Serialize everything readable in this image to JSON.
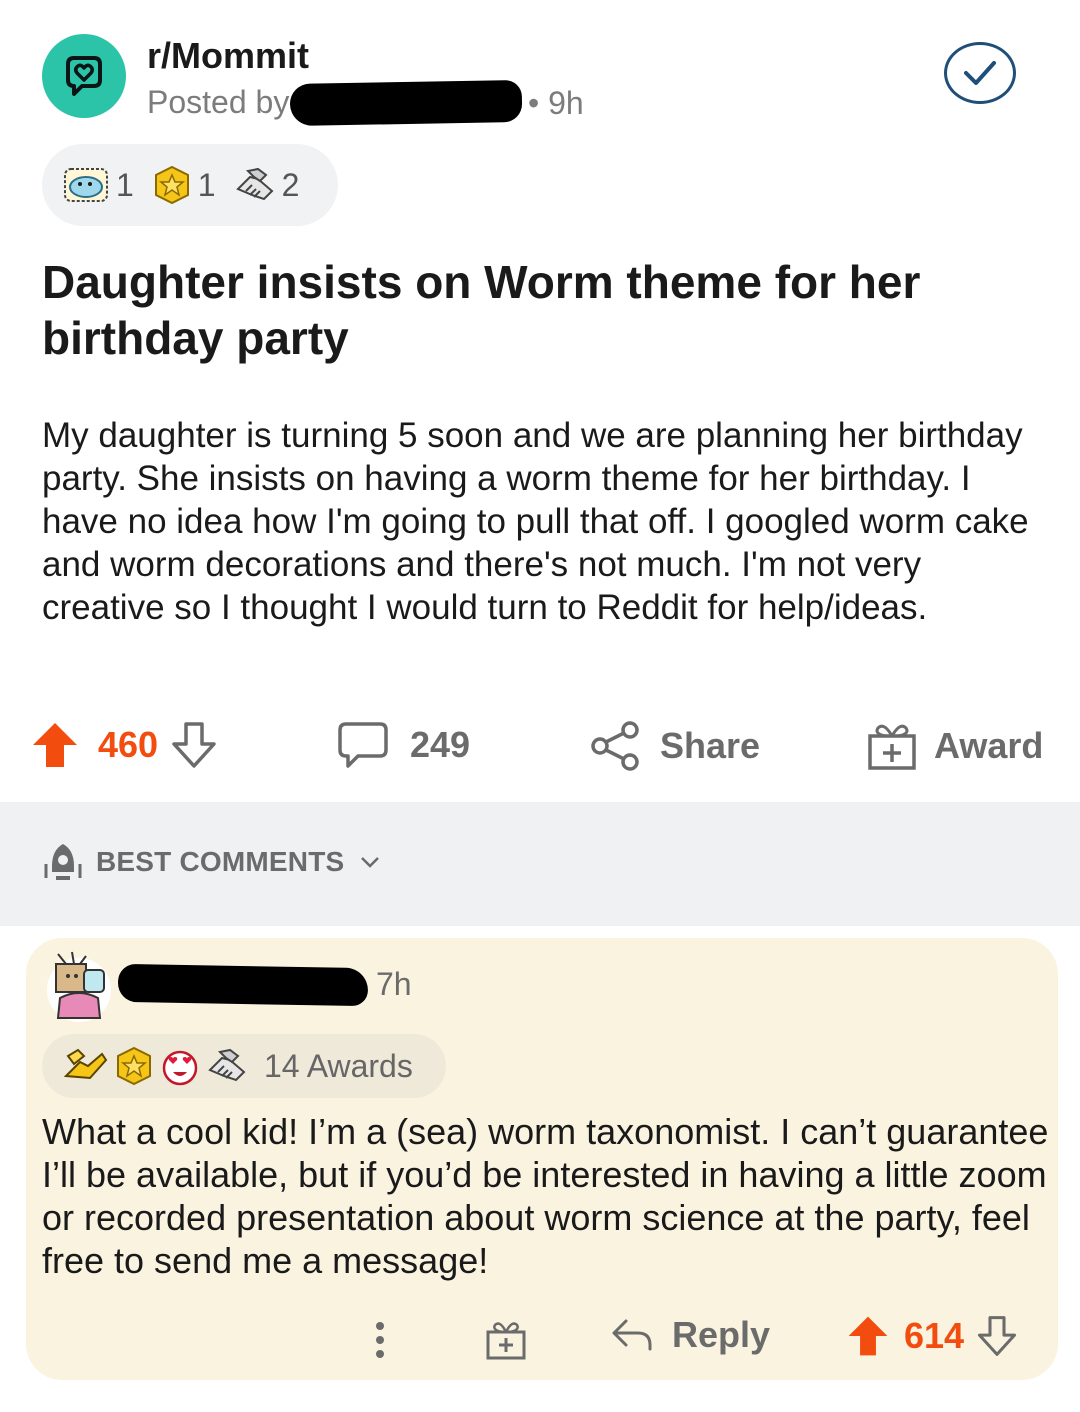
{
  "post": {
    "subreddit": "r/Mommit",
    "posted_by_label": "Posted by",
    "age": "• 9h",
    "awards": [
      {
        "icon": "wholesome-seal-award-icon",
        "count": "1"
      },
      {
        "icon": "gold-star-award-icon",
        "count": "1"
      },
      {
        "icon": "handshake-award-icon",
        "count": "2"
      }
    ],
    "title": "Daughter insists on Worm theme for her birthday party",
    "body": "My daughter is turning 5 soon and we are planning her birthday party. She insists on having a worm theme for her birthday. I have no idea how I'm going to pull that off. I googled worm cake and worm decorations and there's not much. I'm not very creative so I thought I would turn to Reddit for help/ideas.",
    "score": "460",
    "comments_count": "249",
    "share_label": "Share",
    "award_label": "Award"
  },
  "comments_section": {
    "sort_label": "BEST COMMENTS"
  },
  "comment": {
    "age": "7h",
    "awards_label": "14 Awards",
    "award_icons": [
      "helpful-hands-award-icon",
      "gold-star-award-icon",
      "heart-eyes-award-icon",
      "handshake-award-icon"
    ],
    "body": "What a cool kid!  I’m a (sea) worm taxonomist.  I can’t guarantee I’ll be available, but if you’d be interested in having a little zoom or recorded presentation about worm science at the party, feel free to send me a message!",
    "reply_label": "Reply",
    "score": "614"
  },
  "colors": {
    "upvote": "#f24c0f",
    "subreddit_icon_bg": "#2bc4a8",
    "comment_bg": "#faf3e0",
    "section_bg": "#f0f1f3"
  }
}
